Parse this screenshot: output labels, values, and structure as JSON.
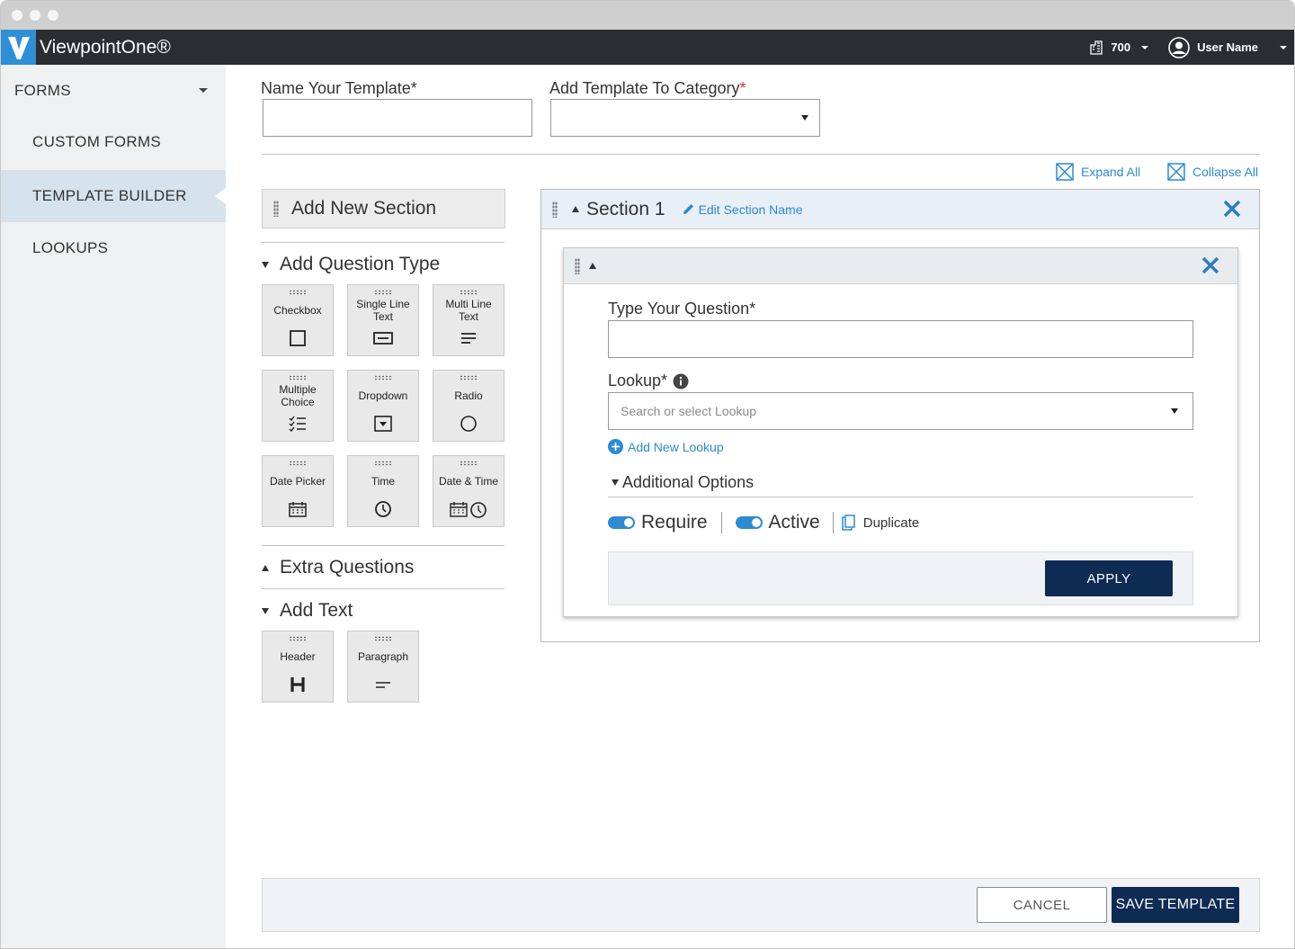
{
  "app": {
    "brand": "ViewpointOne®",
    "company_code": "700",
    "user_name": "User Name"
  },
  "sidebar": {
    "header": "FORMS",
    "items": [
      {
        "label": "CUSTOM FORMS"
      },
      {
        "label": "TEMPLATE BUILDER",
        "active": true
      },
      {
        "label": "LOOKUPS"
      }
    ]
  },
  "form": {
    "name_label": "Name Your Template*",
    "name_value": "",
    "category_label": "Add Template To Category",
    "category_required": "*",
    "category_value": ""
  },
  "toolbar": {
    "expand_all": "Expand All",
    "collapse_all": "Collapse All"
  },
  "palette": {
    "add_section": "Add New Section",
    "question_type_title": "Add Question Type",
    "question_types": [
      {
        "label": "Checkbox",
        "icon": "checkbox-icon"
      },
      {
        "label": "Single Line Text",
        "icon": "single-line-text-icon"
      },
      {
        "label": "Multi Line Text",
        "icon": "multi-line-text-icon"
      },
      {
        "label": "Multiple Choice",
        "icon": "multiple-choice-icon"
      },
      {
        "label": "Dropdown",
        "icon": "dropdown-icon"
      },
      {
        "label": "Radio",
        "icon": "radio-icon"
      },
      {
        "label": "Date Picker",
        "icon": "calendar-icon"
      },
      {
        "label": "Time",
        "icon": "clock-icon"
      },
      {
        "label": "Date & Time",
        "icon": "calendar-clock-icon"
      }
    ],
    "extra_questions_title": "Extra Questions",
    "add_text_title": "Add Text",
    "text_types": [
      {
        "label": "Header",
        "icon": "header-icon"
      },
      {
        "label": "Paragraph",
        "icon": "paragraph-icon"
      }
    ]
  },
  "section": {
    "title": "Section 1",
    "edit_label": "Edit Section Name",
    "question": {
      "question_label": "Type Your Question*",
      "question_value": "",
      "lookup_label": "Lookup*",
      "lookup_placeholder": "Search or select Lookup",
      "add_lookup": "Add New Lookup",
      "additional_options": "Additional Options",
      "require_label": "Require",
      "require_on": true,
      "active_label": "Active",
      "active_on": true,
      "duplicate_label": "Duplicate",
      "apply_label": "APPLY"
    }
  },
  "footer": {
    "cancel_label": "CANCEL",
    "save_label": "SAVE TEMPLATE"
  },
  "colors": {
    "accent": "#2e8ad3",
    "navy": "#0e2b53",
    "topbar": "#2b2d30",
    "required": "#d9302c"
  }
}
